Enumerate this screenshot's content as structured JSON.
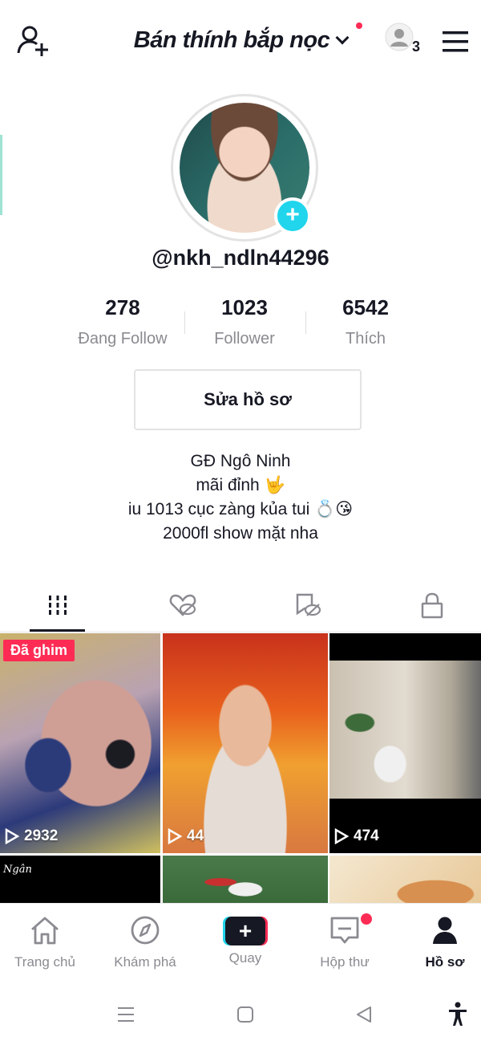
{
  "header": {
    "title": "Bán thính bắp nọc",
    "account_count": "3"
  },
  "profile": {
    "username": "@nkh_ndln44296",
    "stats": [
      {
        "value": "278",
        "label": "Đang Follow"
      },
      {
        "value": "1023",
        "label": "Follower"
      },
      {
        "value": "6542",
        "label": "Thích"
      }
    ],
    "edit_button": "Sửa hồ sơ",
    "bio": [
      "GĐ Ngô Ninh",
      "mãi đỉnh 🤟",
      "iu 1013 cục zàng kủa tui 💍😘",
      "2000fl show mặt nha"
    ]
  },
  "videos": [
    {
      "views": "2932",
      "pinned_label": "Đã ghim"
    },
    {
      "views": "44"
    },
    {
      "views": "474"
    },
    {
      "caption": "Ngân"
    }
  ],
  "nav": {
    "items": [
      "Trang chủ",
      "Khám phá",
      "Quay",
      "Hộp thư",
      "Hồ sơ"
    ]
  },
  "colors": {
    "accent": "#fe2c55",
    "cyan": "#20d5ec",
    "text": "#161823",
    "muted": "#8a8b91"
  }
}
